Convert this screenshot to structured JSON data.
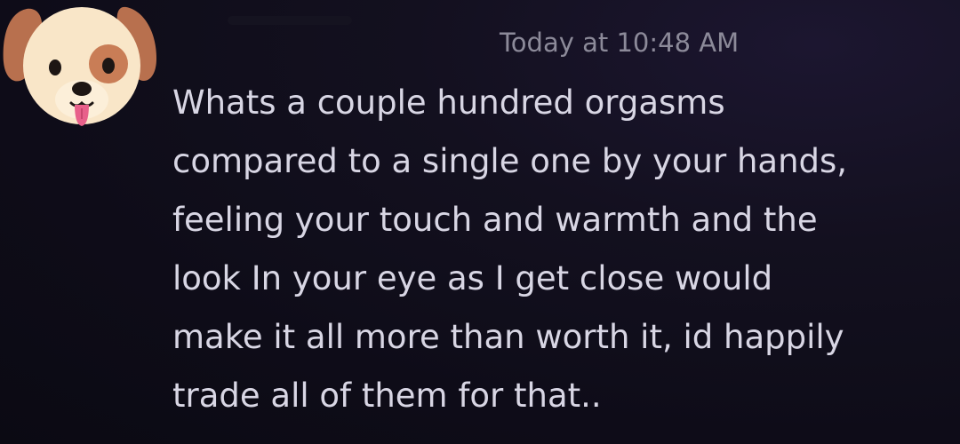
{
  "message": {
    "timestamp": "Today at 10:48 AM",
    "avatar_icon": "dog-face-icon",
    "lines": [
      "Whats a couple hundred orgasms",
      "compared to a single one by your hands,",
      "feeling your touch and warmth and the",
      "look In your eye as I get close would",
      "make it all more than worth it, id happily",
      "trade all of them for that.."
    ]
  },
  "colors": {
    "background": "#0e0c18",
    "text": "#d8d6e4",
    "timestamp": "#8c8a99",
    "dog_face": "#f9e6c8",
    "dog_ear": "#b8704e",
    "dog_tongue": "#e8608a"
  }
}
